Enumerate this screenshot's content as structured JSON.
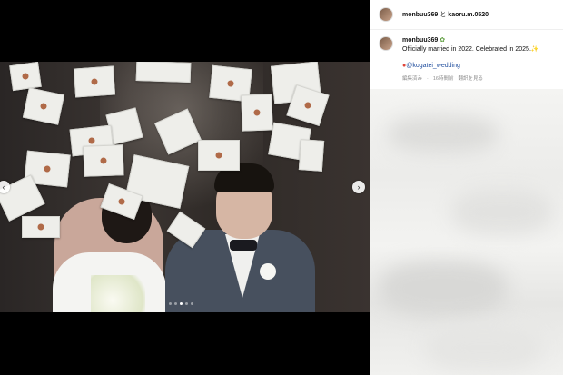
{
  "post": {
    "header": {
      "user1": "monbuu369",
      "connector": "と",
      "user2": "kaoru.m.0520"
    },
    "caption": {
      "username": "monbuu369",
      "verified_icon": "leaf-emoji",
      "text": "Officially married in 2022. Celebrated in 2025.",
      "sparkle_icon": "sparkles-emoji",
      "location_icon": "pin-emoji",
      "mention": "@kogatei_wedding"
    },
    "meta": {
      "edited": "編集済み",
      "separator": "·",
      "time": "16時間前",
      "translate": "翻訳を見る"
    },
    "carousel": {
      "prev_icon": "chevron-left-icon",
      "next_icon": "chevron-right-icon",
      "slide_count": 5,
      "active_slide": 3
    }
  },
  "colors": {
    "mention": "#1c4b9c",
    "meta_text": "#8e8e8e",
    "background": "#000000"
  }
}
